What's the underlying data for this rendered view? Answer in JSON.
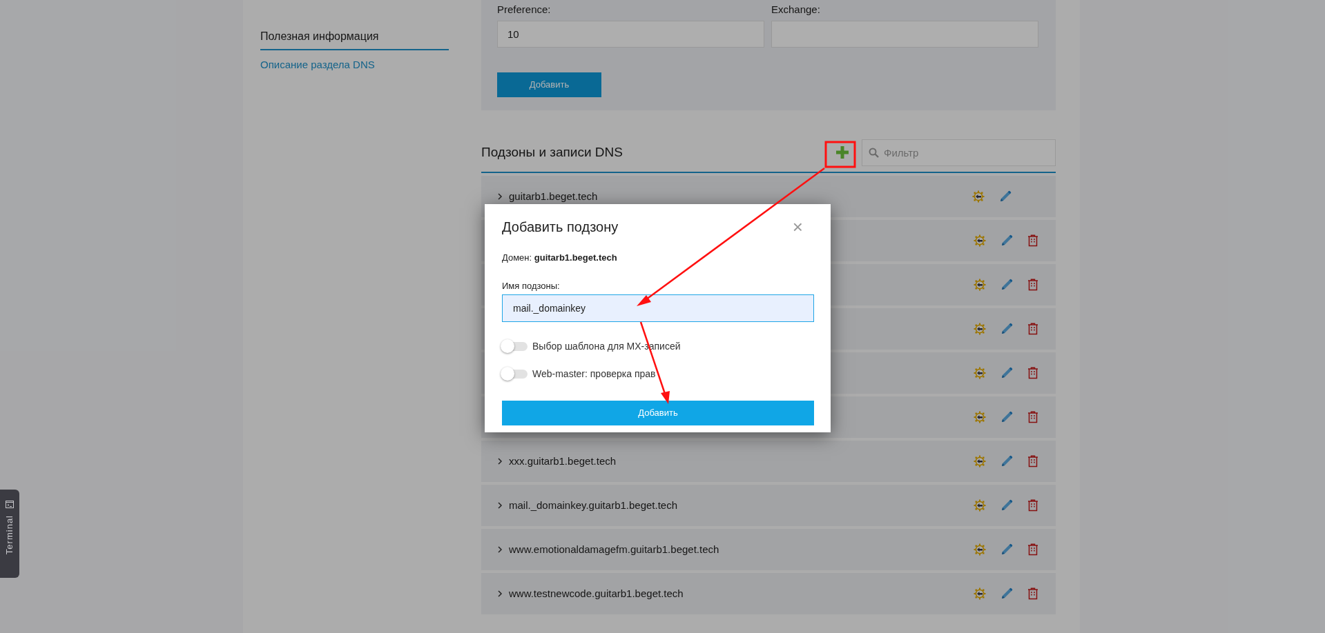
{
  "sidebar": {
    "section_title": "Полезная информация",
    "links": [
      "Описание раздела DNS"
    ]
  },
  "mx_form": {
    "fields": [
      {
        "label": "Preference:",
        "value": "10"
      },
      {
        "label": "Exchange:"
      }
    ],
    "button": "Добавить"
  },
  "records": {
    "title": "Подзоны и записи DNS",
    "filter_placeholder": "Фильтр",
    "rows": [
      {
        "name": "guitarb1.beget.tech",
        "deletable": false
      },
      {
        "deletable": true
      },
      {
        "deletable": true
      },
      {
        "deletable": true
      },
      {
        "deletable": true
      },
      {
        "deletable": true
      },
      {
        "name": "xxx.guitarb1.beget.tech",
        "deletable": true
      },
      {
        "name": "mail._domainkey.guitarb1.beget.tech",
        "deletable": true
      },
      {
        "name": "www.emotionaldamagefm.guitarb1.beget.tech",
        "deletable": true
      },
      {
        "name": "www.testnewcode.guitarb1.beget.tech",
        "deletable": true
      }
    ]
  },
  "dialog": {
    "title": "Добавить подзону",
    "close": "×",
    "domain": "Домен: **guitarb1.beget.tech**",
    "field_label": "Имя подзоны:",
    "field_value": "mail._domainkey",
    "toggles": [
      {
        "label": "Выбор шаблона для MX-записей",
        "on": false
      },
      {
        "label": "Web-master: проверка прав",
        "on": false
      }
    ],
    "button": "Добавить"
  },
  "terminal_tab": {
    "label": "Terminal"
  }
}
